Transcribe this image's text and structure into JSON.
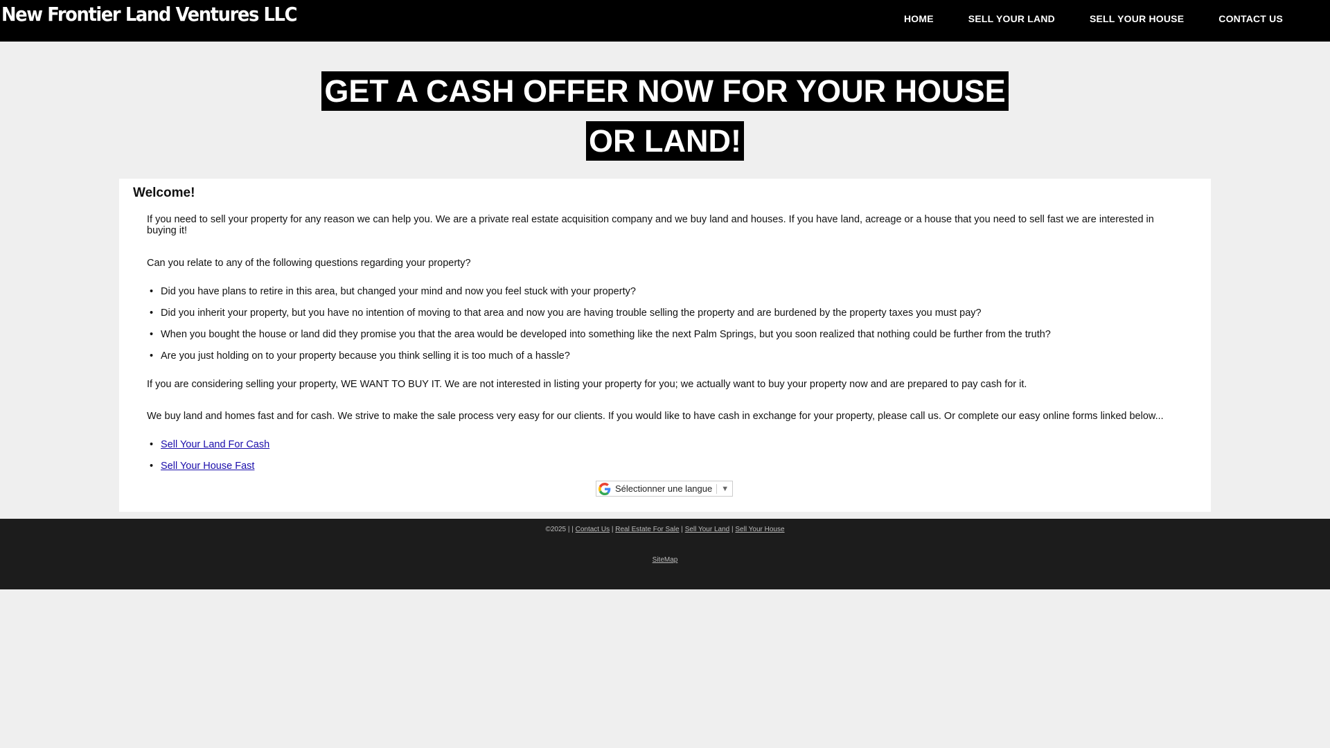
{
  "header": {
    "brand": "New Frontier Land Ventures LLC",
    "nav": [
      "HOME",
      "SELL YOUR LAND",
      "SELL YOUR HOUSE",
      "CONTACT US"
    ]
  },
  "hero": {
    "headline": "GET A CASH OFFER NOW FOR YOUR HOUSE OR LAND!"
  },
  "content": {
    "title": "Welcome!",
    "intro": "If you need to sell your property for any reason we can help you. We are a private real estate acquisition company and we buy land and houses. If you have land, acreage or a house that you need to sell fast we are interested in buying it!",
    "question": "Can you relate to any of the following questions regarding your property?",
    "questions": [
      "Did you have plans to retire in this area, but changed your mind and now you feel stuck with your property?",
      "Did you inherit your property, but you have no intention of moving to that area and now you are having trouble selling the property and are burdened by the property taxes you must pay?",
      "When you bought the house or land did they promise you that the area would be developed into something like the next Palm Springs, but you soon realized that nothing could be further from the truth?",
      "Are you just holding on to your property because you think selling it is too much of a hassle?"
    ],
    "para_want": "If you are considering selling your property, WE WANT TO BUY IT. We are not interested in listing your property for you; we actually want to buy your property now and are prepared to pay cash for it.",
    "para_cash": "We buy land and homes fast and for cash. We strive to make the sale process very easy for our clients. If you would like to have cash in exchange for your property, please call us. Or complete our easy online forms linked below...",
    "links": [
      "Sell Your Land For Cash",
      "Sell Your House Fast"
    ]
  },
  "translate": {
    "label": "Sélectionner une langue",
    "arrow": "▼",
    "icon": "google-g-icon"
  },
  "footer": {
    "copyright": "©2025 | |",
    "links": [
      "Contact Us",
      "Real Estate For Sale",
      "Sell Your Land",
      "Sell Your House"
    ],
    "sitemap": "SiteMap"
  },
  "colors": {
    "header_bg": "#000000",
    "footer_bg": "#1c1c1c",
    "link": "#1a0dab"
  }
}
